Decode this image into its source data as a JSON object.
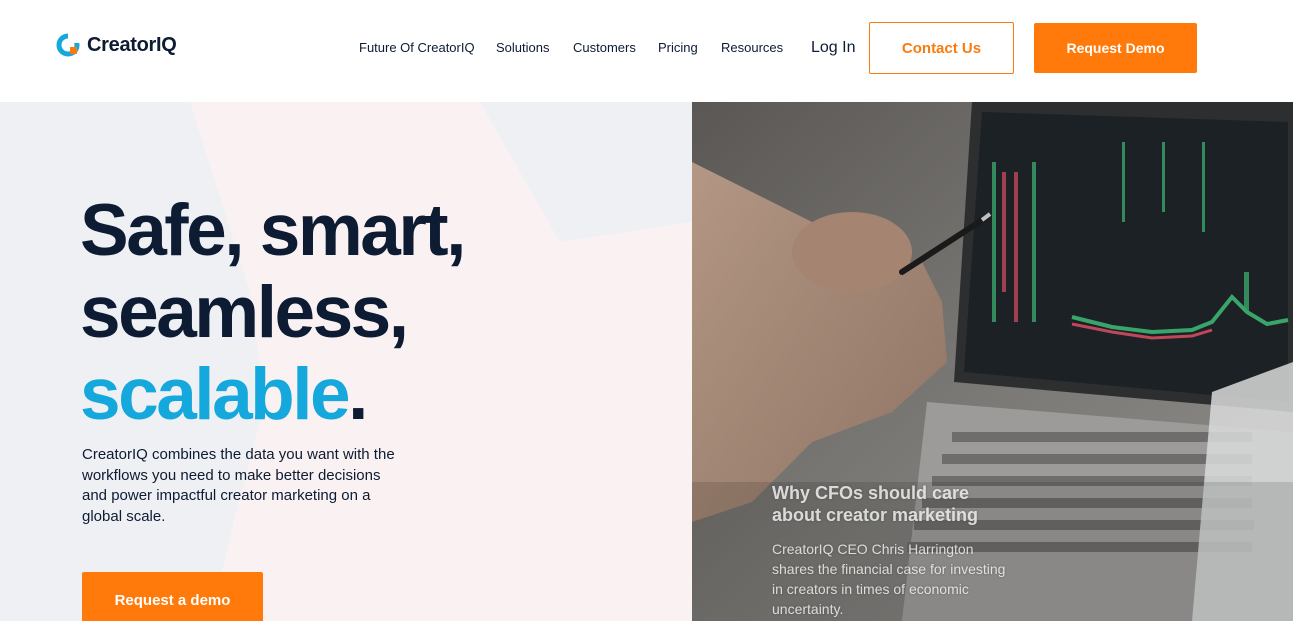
{
  "header": {
    "brand": "CreatorIQ",
    "nav": [
      "Future Of CreatorIQ",
      "Solutions",
      "Customers",
      "Pricing",
      "Resources"
    ],
    "login": "Log In",
    "contact": "Contact Us",
    "request_demo": "Request Demo"
  },
  "hero": {
    "headline_line1": "Safe, smart,",
    "headline_line2": "seamless,",
    "headline_accent": "scalable",
    "headline_period": ".",
    "description": "CreatorIQ combines the data you want with the workflows you need to make better decisions and power impactful creator marketing on a global scale.",
    "cta": "Request a demo"
  },
  "feature": {
    "title": "Why CFOs should care about creator marketing",
    "body": "CreatorIQ CEO Chris Harrington shares the financial case for investing in creators in times of economic uncertainty."
  },
  "colors": {
    "navy": "#0d1b33",
    "accent_blue": "#14a8dc",
    "orange": "#ff7a0a"
  },
  "icons": {
    "logo": "creatoriq-logo-icon"
  }
}
